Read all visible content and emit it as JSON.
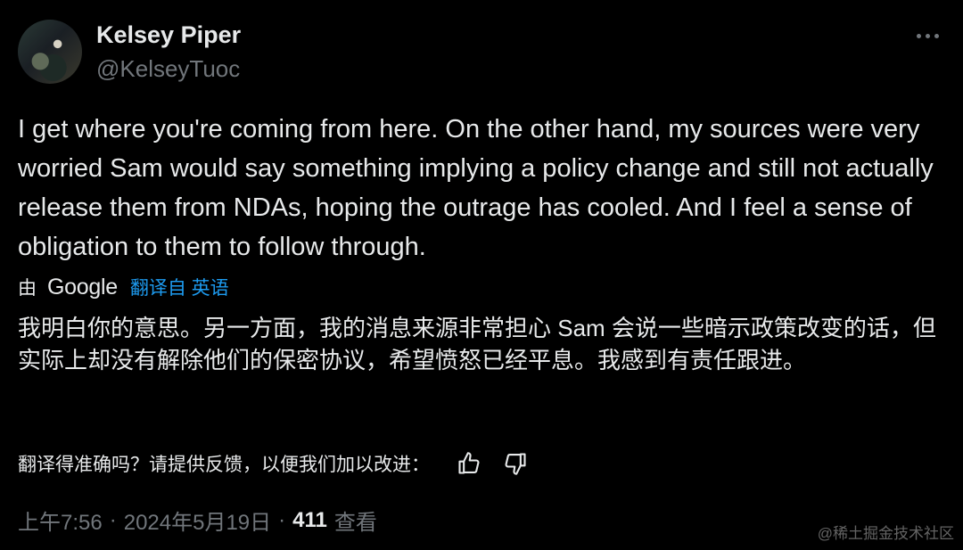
{
  "author": {
    "name": "Kelsey Piper",
    "handle": "@KelseyTuoc"
  },
  "tweet": {
    "text": "I get where you're coming from here. On the other hand, my sources were very worried Sam would say something implying a policy change and still not actually release them from NDAs, hoping the outrage has cooled. And I feel a sense of obligation to them to follow through."
  },
  "translation": {
    "by_label": "由",
    "provider": "Google",
    "translated_from": "翻译自 英语",
    "text": "我明白你的意思。另一方面，我的消息来源非常担心 Sam 会说一些暗示政策改变的话，但实际上却没有解除他们的保密协议，希望愤怒已经平息。我感到有责任跟进。"
  },
  "feedback": {
    "question": "翻译得准确吗？请提供反馈，以便我们加以改进："
  },
  "meta": {
    "time": "上午7:56",
    "date": "2024年5月19日",
    "views_count": "411",
    "views_label": "查看"
  },
  "watermark": "@稀土掘金技术社区",
  "icons": {
    "more": "more-icon",
    "thumbs_up": "thumbs-up-icon",
    "thumbs_down": "thumbs-down-icon"
  },
  "colors": {
    "background": "#000000",
    "text": "#e7e9ea",
    "secondary": "#71767b",
    "link": "#1d9bf0"
  }
}
